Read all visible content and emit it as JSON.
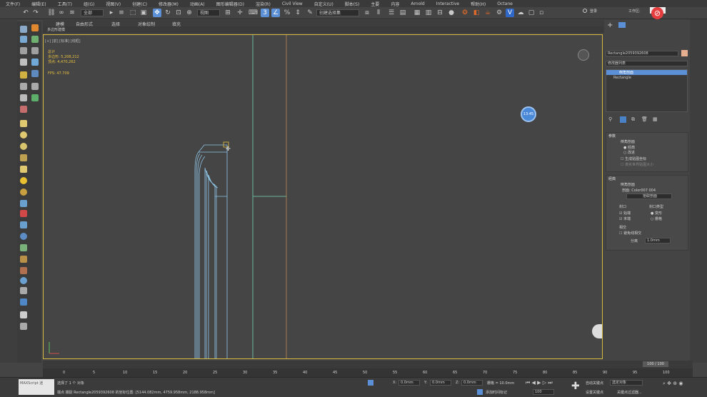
{
  "menu": [
    "文件(F)",
    "编辑(E)",
    "工具(T)",
    "组(G)",
    "视图(V)",
    "创建(C)",
    "修改器(M)",
    "动画(A)",
    "图形编辑器(D)",
    "渲染(R)",
    "Civil View",
    "自定义(U)",
    "脚本(S)",
    "主要",
    "内容",
    "Arnold",
    "Interactive",
    "帮助(H)",
    "Octane"
  ],
  "toolbar": {
    "select_filter": "全部",
    "view_dropdown": "视图",
    "selection_set": "创建选择集",
    "signin": "登录",
    "workspace": "工作区:"
  },
  "ribbon": {
    "tabs": [
      "建模",
      "自由形式",
      "选择",
      "对象绘制",
      "填充"
    ],
    "subtitle": "多边形建模"
  },
  "viewport": {
    "label": "[+] [前] [标准] [线框]",
    "stats_title": "总计",
    "polys_label": "多边形:",
    "polys": "5,208,212",
    "verts_label": "顶点:",
    "verts": "4,470,262",
    "fps_label": "FPS:",
    "fps": "47.709",
    "time_badge": "13:45"
  },
  "command_panel": {
    "object_name": "Rectangle2059392608",
    "modifier_list": "修改器列表",
    "stack": [
      "倒角剖面",
      "Rectangle"
    ],
    "params": {
      "title": "参数",
      "profile_label": "倒角剖面",
      "opt_classic": "经典",
      "opt_improved": "改进",
      "gen_mapping": "生成贴图坐标",
      "real_world": "真实世界贴图大小"
    },
    "classic": {
      "title": "经典",
      "section": "倒角剖面",
      "profile_prefix": "剖面:",
      "profile_value": "Color007 004",
      "pick_button": "拾取剖面",
      "caps_label": "封口",
      "cap_start": "始端",
      "cap_end": "末端",
      "cap_type_label": "封口类型",
      "morph": "变形",
      "grid": "栅格",
      "intersect_label": "相交",
      "avoid_intersect": "避免线相交",
      "separation_label": "分离",
      "separation_value": "1.0mm"
    }
  },
  "timeline": {
    "frame": "100 / 100",
    "ticks": [
      "0",
      "5",
      "10",
      "15",
      "20",
      "25",
      "30",
      "35",
      "40",
      "45",
      "50",
      "55",
      "60",
      "65",
      "70",
      "75",
      "80",
      "85",
      "90",
      "95",
      "100"
    ]
  },
  "status": {
    "maxscript": "MAXScript 迷",
    "selected": "选择了 1 个 对象",
    "snap": "端点 捕捉 Rectangle2059392608 的坐标位置: [5144.082mm, 4759.958mm, 2188.958mm]",
    "x_label": "X:",
    "x": "0.0mm",
    "y_label": "Y:",
    "y": "0.0mm",
    "z_label": "Z:",
    "z": "0.0mm",
    "grid": "栅格 = 10.0mm",
    "add_time_tag": "添加时间标记",
    "auto_key": "自动关键点",
    "set_key": "设置关键点",
    "selected_obj": "选定对象",
    "key_filters": "关键点过滤器...",
    "frame_value": "100"
  },
  "colors": {
    "accent": "#5b8fd6",
    "viewport_border": "#d8b940",
    "stats": "#e8c040",
    "blue_lines": "#8fc4e6",
    "green_lines": "#6ab7a0",
    "orange_lines": "#a87a50"
  }
}
